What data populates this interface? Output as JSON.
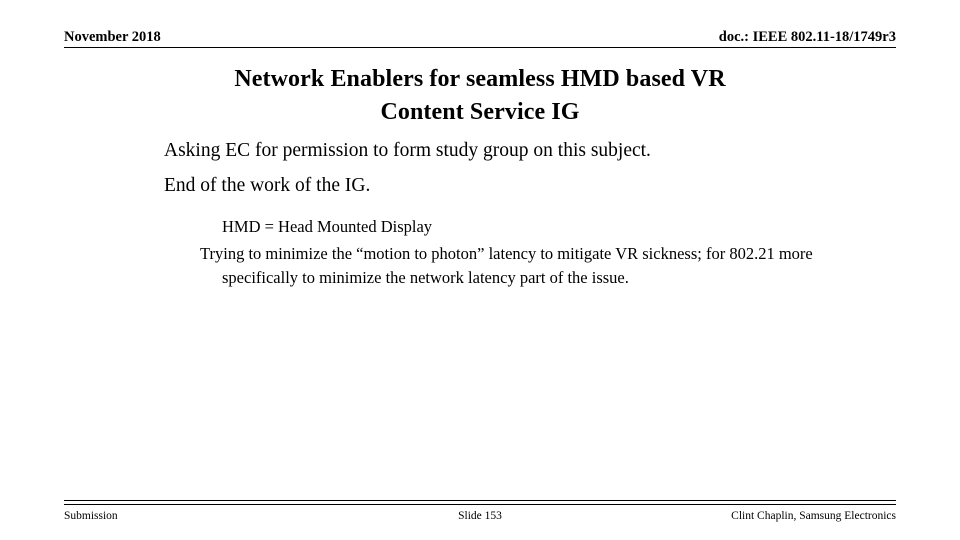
{
  "header": {
    "date": "November 2018",
    "doc": "doc.: IEEE 802.11-18/1749r3"
  },
  "title": {
    "line1": "Network Enablers for seamless HMD based VR",
    "line2": "Content Service IG"
  },
  "body": {
    "level1": [
      "Asking EC for permission to form study group on this subject.",
      "End of the work of the IG."
    ],
    "level2": [
      "HMD = Head Mounted Display",
      "Trying to minimize the “motion to photon” latency to mitigate VR sickness; for 802.21 more specifically to minimize the network latency part of the issue."
    ]
  },
  "footer": {
    "left": "Submission",
    "center": "Slide 153",
    "right": "Clint Chaplin, Samsung Electronics"
  }
}
